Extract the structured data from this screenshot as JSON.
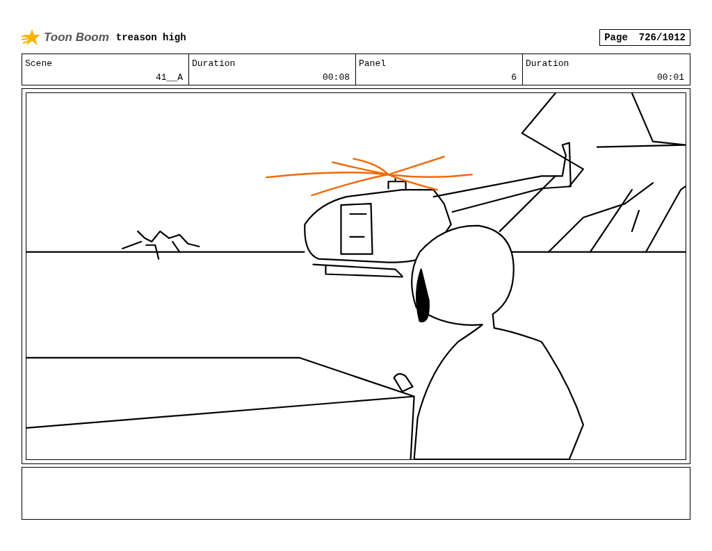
{
  "header": {
    "logo": "Toon Boom",
    "title": "treason high",
    "page_label": "Page",
    "page": "726/1012"
  },
  "info": [
    {
      "label": "Scene",
      "value": "41__A"
    },
    {
      "label": "Duration",
      "value": "00:08"
    },
    {
      "label": "Panel",
      "value": "6"
    },
    {
      "label": "Duration",
      "value": "00:01"
    }
  ]
}
